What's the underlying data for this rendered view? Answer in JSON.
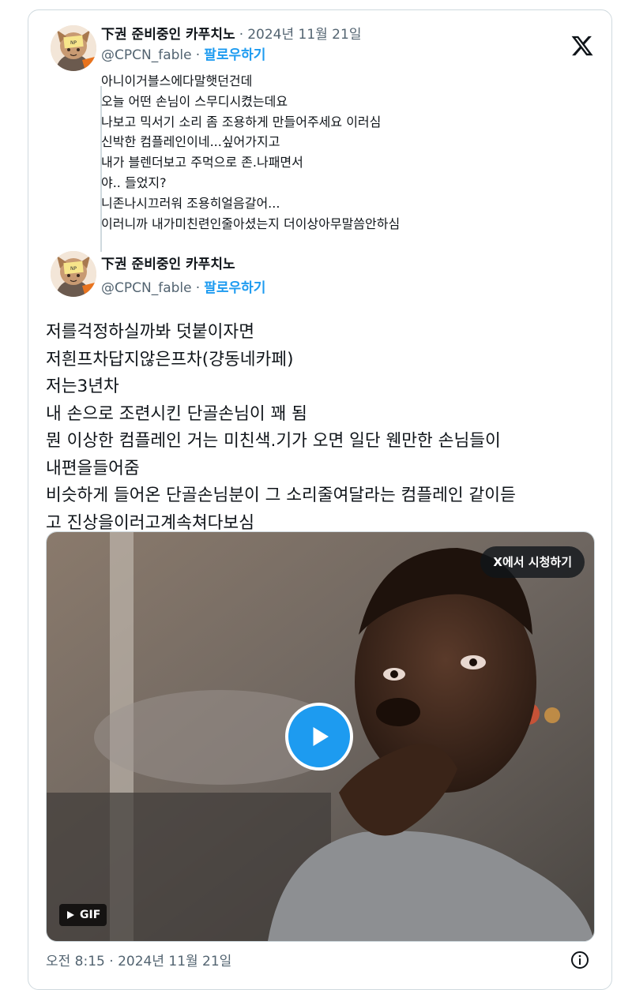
{
  "quoted_tweet": {
    "author_name": "下권 준비중인 카푸치노",
    "separator": "·",
    "date": "2024년 11월 21일",
    "handle": "@CPCN_fable",
    "follow_label": "팔로우하기",
    "lines": [
      "아니이거블스에다말햇던건데",
      "오늘 어떤 손님이 스무디시켰는데요",
      "나보고 믹서기 소리 좀 조용하게 만들어주세요 이러심",
      "신박한 컴플레인이네...싶어가지고",
      "내가 블렌더보고 주먹으로 존.나패면서",
      "야.. 들었지?",
      "니존나시끄러워 조용히얼음갈어...",
      "이러니까 내가미친련인줄아셨는지 더이상아무말씀안하심"
    ]
  },
  "main_tweet": {
    "author_name": "下권 준비중인 카푸치노",
    "handle": "@CPCN_fable",
    "separator": "·",
    "follow_label": "팔로우하기",
    "lines": [
      "저를걱정하실까봐 덧붙이자면",
      "저흰프차답지않은프차(걍동네카페)",
      "저는3년차",
      "내 손으로 조련시킨 단골손님이 꽤 됨",
      "뭔 이상한 컴플레인 거는 미친색.기가 오면 일단 웬만한 손님들이",
      "내편을들어줌",
      "비슷하게 들어온 단골손님분이 그 소리줄여달라는 컴플레인 같이듣",
      "고 진상을이러고계속쳐다보심"
    ]
  },
  "media": {
    "watch_label": "X에서 시청하기",
    "gif_label": "GIF"
  },
  "footer": {
    "timestamp": "오전 8:15 · 2024년 11월 21일"
  },
  "colors": {
    "accent": "#1d9bf0",
    "text": "#0f1419",
    "muted": "#536471",
    "border": "#cfd9de"
  },
  "icons": {
    "brand": "x-logo-icon",
    "play": "play-icon",
    "info": "info-icon"
  }
}
